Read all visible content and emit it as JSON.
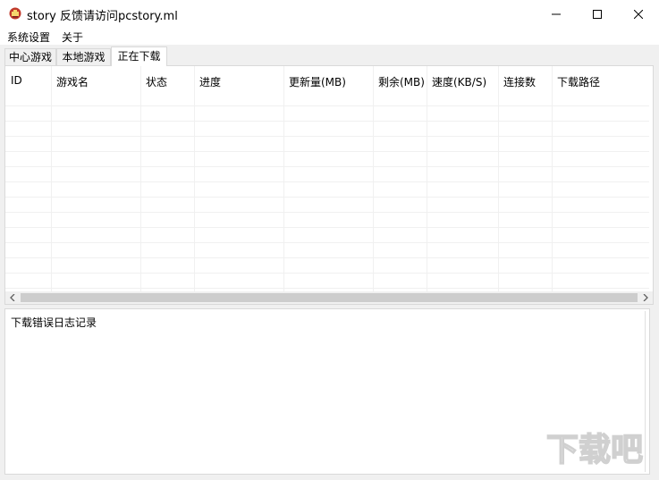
{
  "window": {
    "title": "story 反馈请访问pcstory.ml",
    "icon": "app-logo-icon",
    "controls": [
      "minimize-icon",
      "maximize-icon",
      "close-icon"
    ]
  },
  "menu": {
    "items": [
      "系统设置",
      "关于"
    ]
  },
  "tabs": [
    {
      "label": "中心游戏",
      "active": false
    },
    {
      "label": "本地游戏",
      "active": false
    },
    {
      "label": "正在下载",
      "active": true
    }
  ],
  "table": {
    "columns": [
      "ID",
      "游戏名",
      "状态",
      "进度",
      "更新量(MB)",
      "剩余(MB)",
      "速度(KB/S)",
      "连接数",
      "下载路径"
    ],
    "rows": []
  },
  "log": {
    "label": "下载错误日志记录"
  },
  "watermark": {
    "text": "下载吧"
  }
}
